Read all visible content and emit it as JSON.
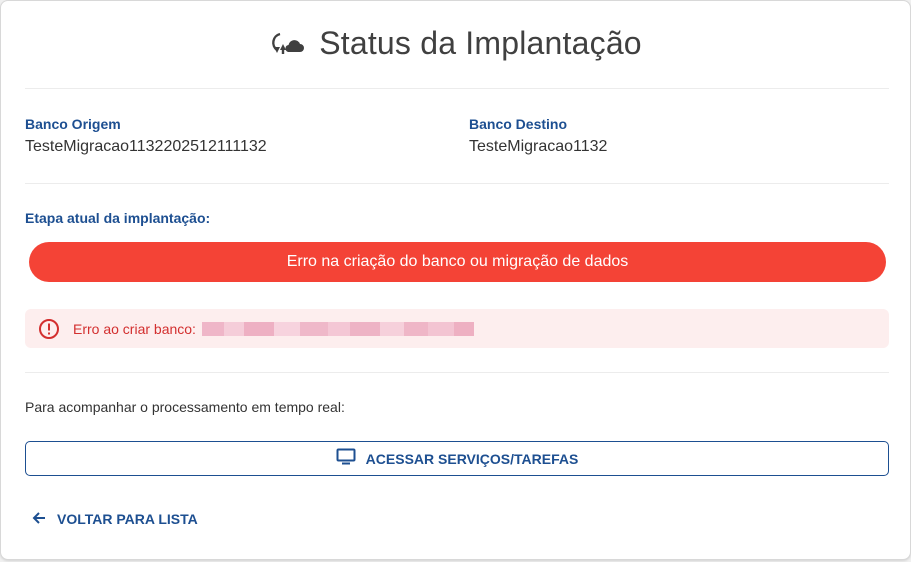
{
  "header": {
    "title": "Status da Implantação",
    "icon": "cloud-sync-icon"
  },
  "source_db": {
    "label": "Banco Origem",
    "value": "TesteMigracao1132202512111132"
  },
  "target_db": {
    "label": "Banco Destino",
    "value": "TesteMigracao1132"
  },
  "stage": {
    "label": "Etapa atual da implantação:",
    "status_text": "Erro na criação do banco ou migração de dados",
    "status_color": "#f44336"
  },
  "error_alert": {
    "icon": "error-circle-icon",
    "text": "Erro ao criar banco:",
    "color": "#d32f2f",
    "background": "#fdeeee"
  },
  "realtime": {
    "hint": "Para acompanhar o processamento em tempo real:",
    "button_label": "ACESSAR SERVIÇOS/TAREFAS",
    "button_icon": "monitor-icon"
  },
  "back": {
    "label": "VOLTAR PARA LISTA",
    "icon": "arrow-left-icon"
  },
  "colors": {
    "accent": "#1d4f91",
    "error": "#f44336"
  }
}
